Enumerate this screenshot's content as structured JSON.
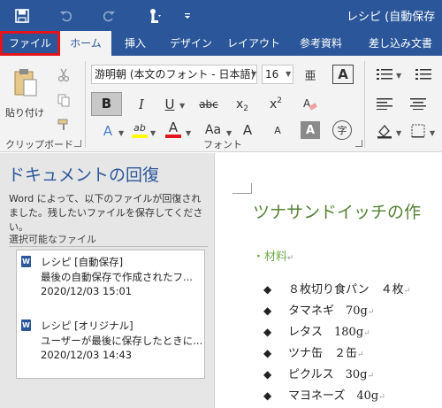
{
  "titlebar": {
    "title": "レシピ (自動保存",
    "save_icon": "save-icon",
    "undo_icon": "undo-icon",
    "redo_icon": "redo-icon",
    "touch_icon": "touch-mode-icon",
    "customize_icon": "customize-qat-icon"
  },
  "tabs": [
    {
      "label": "ファイル"
    },
    {
      "label": "ホーム"
    },
    {
      "label": "挿入"
    },
    {
      "label": "デザイン"
    },
    {
      "label": "レイアウト"
    },
    {
      "label": "参考資料"
    },
    {
      "label": "差し込み文書"
    }
  ],
  "ribbon": {
    "clipboard": {
      "group_label": "クリップボード",
      "paste_label": "貼り付け"
    },
    "font": {
      "group_label": "フォント",
      "font_name": "游明朝 (本文のフォント - 日本語)",
      "font_size": "16",
      "bold": "B",
      "italic": "I",
      "underline": "U",
      "strike": "abc",
      "subscript": "x",
      "superscript": "x",
      "sub_mark": "2",
      "sup_mark": "2",
      "grow": "A",
      "shrink": "A",
      "case": "Aa",
      "clear": "A",
      "char_border": "A",
      "ruby": "亜",
      "highlight": "ab",
      "font_color": "A",
      "shading": "A",
      "circle": "字"
    },
    "colors": {
      "highlight": "#ffff00",
      "font_color": "#e3141a",
      "accent": "#2b579a"
    }
  },
  "recovery": {
    "title": "ドキュメントの回復",
    "description": "Word によって、以下のファイルが回復されました。残したいファイルを保存してください。",
    "available_label": "選択可能なファイル",
    "files": [
      {
        "name": "レシピ [自動保存]",
        "desc": "最後の自動保存で作成されたフ...",
        "time": "2020/12/03 15:01"
      },
      {
        "name": "レシピ [オリジナル]",
        "desc": "ユーザーが最後に保存したときに...",
        "time": "2020/12/03 14:43"
      }
    ]
  },
  "document": {
    "title": "ツナサンドイッチの作",
    "heading": "・材料",
    "para_mark": "↵",
    "bullet": "◆",
    "ingredients": [
      {
        "text": "８枚切り食パン　４枚"
      },
      {
        "text": "タマネギ　70g"
      },
      {
        "text": "レタス　180g"
      },
      {
        "text": "ツナ缶　２缶"
      },
      {
        "text": "ピクルス　30g"
      },
      {
        "text": "マヨネーズ　40g"
      }
    ]
  }
}
